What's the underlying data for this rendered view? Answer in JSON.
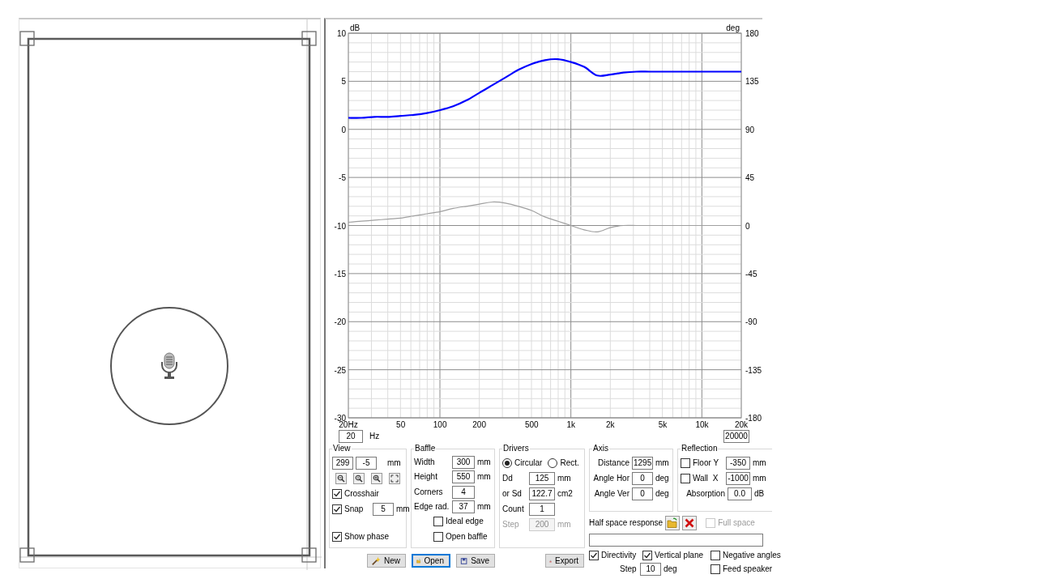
{
  "chart": {
    "chart_data": {
      "type": "line",
      "grid": true,
      "ylabel": "dB",
      "y2label": "deg",
      "ylim": [
        -30,
        10
      ],
      "y2lim": [
        -180,
        180
      ],
      "categories": [
        "20Hz",
        null,
        null,
        null,
        "50",
        null,
        null,
        "100",
        null,
        null,
        "200",
        null,
        null,
        null,
        "500",
        null,
        null,
        "1k",
        null,
        null,
        "2k",
        null,
        null,
        null,
        "5k",
        null,
        null,
        "10k",
        null,
        null,
        "20k"
      ],
      "yticks": [
        -30,
        -25,
        -20,
        -15,
        -10,
        -5,
        0,
        5,
        10
      ],
      "y2ticks": [
        -180,
        -135,
        -90,
        -45,
        0,
        45,
        90,
        135,
        180
      ],
      "series": [
        {
          "color": "#0000ff",
          "values": [
            1.2,
            1.2,
            1.3,
            1.3,
            1.4,
            1.5,
            1.7,
            2.0,
            2.4,
            3.0,
            3.8,
            4.6,
            5.4,
            6.2,
            6.8,
            7.2,
            7.3,
            7.0,
            6.5,
            5.6,
            5.7,
            5.9,
            6.0,
            6.0,
            6.0,
            6.0,
            6.0,
            6.0,
            6.0,
            6.0,
            6.0
          ]
        },
        {
          "color": "#a0a0a0",
          "axis": "y2",
          "values": [
            3,
            4,
            5,
            6,
            7,
            9,
            11,
            13,
            16,
            18,
            20,
            22,
            21,
            18,
            14,
            8,
            4,
            0,
            -4,
            -6,
            -2,
            0,
            0,
            0,
            0,
            0,
            0,
            0,
            0,
            0,
            0
          ]
        }
      ]
    }
  },
  "frequency_range": {
    "from": "20",
    "unit": "Hz",
    "to": "20000"
  },
  "groups": [
    {
      "title": "View",
      "items": [
        {
          "kind": "pair",
          "values": [
            "299",
            "-5"
          ],
          "unit": "mm"
        },
        {
          "kind": "tools"
        },
        {
          "kind": "check",
          "label": "Crosshair",
          "checked": true
        },
        {
          "kind": "check-field",
          "label": "Snap",
          "checked": true,
          "value": "5",
          "unit": "mm"
        },
        {
          "kind": "check",
          "label": "Show phase",
          "checked": true
        }
      ]
    },
    {
      "title": "Baffle",
      "items": [
        {
          "kind": "field",
          "label": "Width",
          "value": "300",
          "unit": "mm"
        },
        {
          "kind": "field",
          "label": "Height",
          "value": "550",
          "unit": "mm"
        },
        {
          "kind": "field",
          "label": "Corners",
          "value": "4"
        },
        {
          "kind": "field",
          "label": "Edge rad.",
          "value": "37",
          "unit": "mm"
        },
        {
          "kind": "check",
          "label": "Ideal edge",
          "checked": false
        },
        {
          "kind": "check",
          "label": "Open baffle",
          "checked": false
        }
      ]
    },
    {
      "title": "Drivers",
      "items": [
        {
          "kind": "radio",
          "options": [
            {
              "label": "Circular",
              "selected": true
            },
            {
              "label": "Rect.",
              "selected": false
            }
          ]
        },
        {
          "kind": "field",
          "label": "Dd",
          "value": "125",
          "unit": "mm"
        },
        {
          "kind": "field",
          "label": "or Sd",
          "value": "122.7",
          "unit": "cm2"
        },
        {
          "kind": "field",
          "label": "Count",
          "value": "1"
        },
        {
          "kind": "field",
          "label": "Step",
          "value": "200",
          "unit": "mm",
          "disabled": true
        }
      ]
    }
  ],
  "buttons": [
    {
      "label": "New",
      "focused": false
    },
    {
      "label": "Open",
      "focused": true
    },
    {
      "label": "Save",
      "focused": false
    },
    {
      "label": "Export",
      "focused": false
    }
  ],
  "side_groups": [
    {
      "title": "Axis",
      "items": [
        {
          "kind": "field",
          "label": "Distance",
          "value": "1295",
          "unit": "mm"
        },
        {
          "kind": "field",
          "label": "Angle Hor",
          "value": "0",
          "unit": "deg"
        },
        {
          "kind": "field",
          "label": "Angle Ver",
          "value": "0",
          "unit": "deg"
        }
      ]
    },
    {
      "title": "Reflection",
      "items": [
        {
          "kind": "check-field",
          "label": "Floor Y",
          "checked": false,
          "value": "-350",
          "unit": "mm"
        },
        {
          "kind": "check-field",
          "label": "Wall  X",
          "checked": false,
          "value": "-1000",
          "unit": "mm"
        },
        {
          "kind": "field",
          "label": "Absorption",
          "value": "0.0",
          "unit": "dB"
        }
      ]
    }
  ],
  "half_space": {
    "label": "Half space response",
    "full_space": {
      "label": "Full space",
      "checked": false,
      "disabled": true
    }
  },
  "options": [
    {
      "kind": "check",
      "label": "Directivity",
      "checked": true
    },
    {
      "kind": "check",
      "label": "Vertical plane",
      "checked": true
    },
    {
      "kind": "check",
      "label": "Negative angles",
      "checked": false
    },
    {
      "kind": "field",
      "label": "Step",
      "value": "10",
      "unit": "deg"
    },
    {
      "kind": "check",
      "label": "Feed speaker",
      "checked": false
    }
  ]
}
